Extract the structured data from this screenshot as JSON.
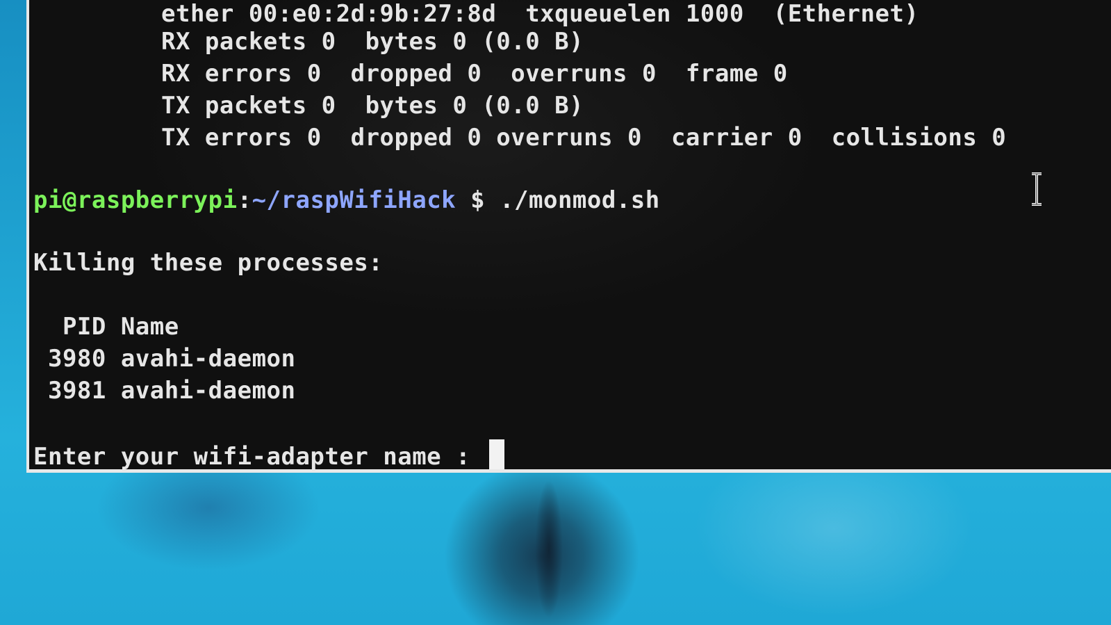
{
  "terminal": {
    "lines": {
      "ether": "ether 00:e0:2d:9b:27:8d  txqueuelen 1000  (Ethernet)",
      "rx_packets": "RX packets 0  bytes 0 (0.0 B)",
      "rx_errors": "RX errors 0  dropped 0  overruns 0  frame 0",
      "tx_packets": "TX packets 0  bytes 0 (0.0 B)",
      "tx_errors": "TX errors 0  dropped 0 overruns 0  carrier 0  collisions 0"
    },
    "prompt": {
      "user_host": "pi@raspberrypi",
      "separator": ":",
      "path": "~/raspWifiHack",
      "symbol": " $ ",
      "command": "./monmod.sh"
    },
    "killing_message": "Killing these processes:",
    "process_table": {
      "header": "  PID Name",
      "rows": [
        {
          "pid": " 3980",
          "name": "avahi-daemon"
        },
        {
          "pid": " 3981",
          "name": "avahi-daemon"
        }
      ]
    },
    "input_prompt": "Enter your wifi-adapter name : "
  },
  "colors": {
    "terminal_bg": "#101010",
    "text": "#e6e6e6",
    "prompt_user": "#7cf25a",
    "prompt_path": "#8ea6ff",
    "desktop_accent": "#25b1dc"
  },
  "icons": {
    "mouse_pointer": "i-beam-cursor-icon",
    "text_cursor": "block-cursor-icon"
  }
}
